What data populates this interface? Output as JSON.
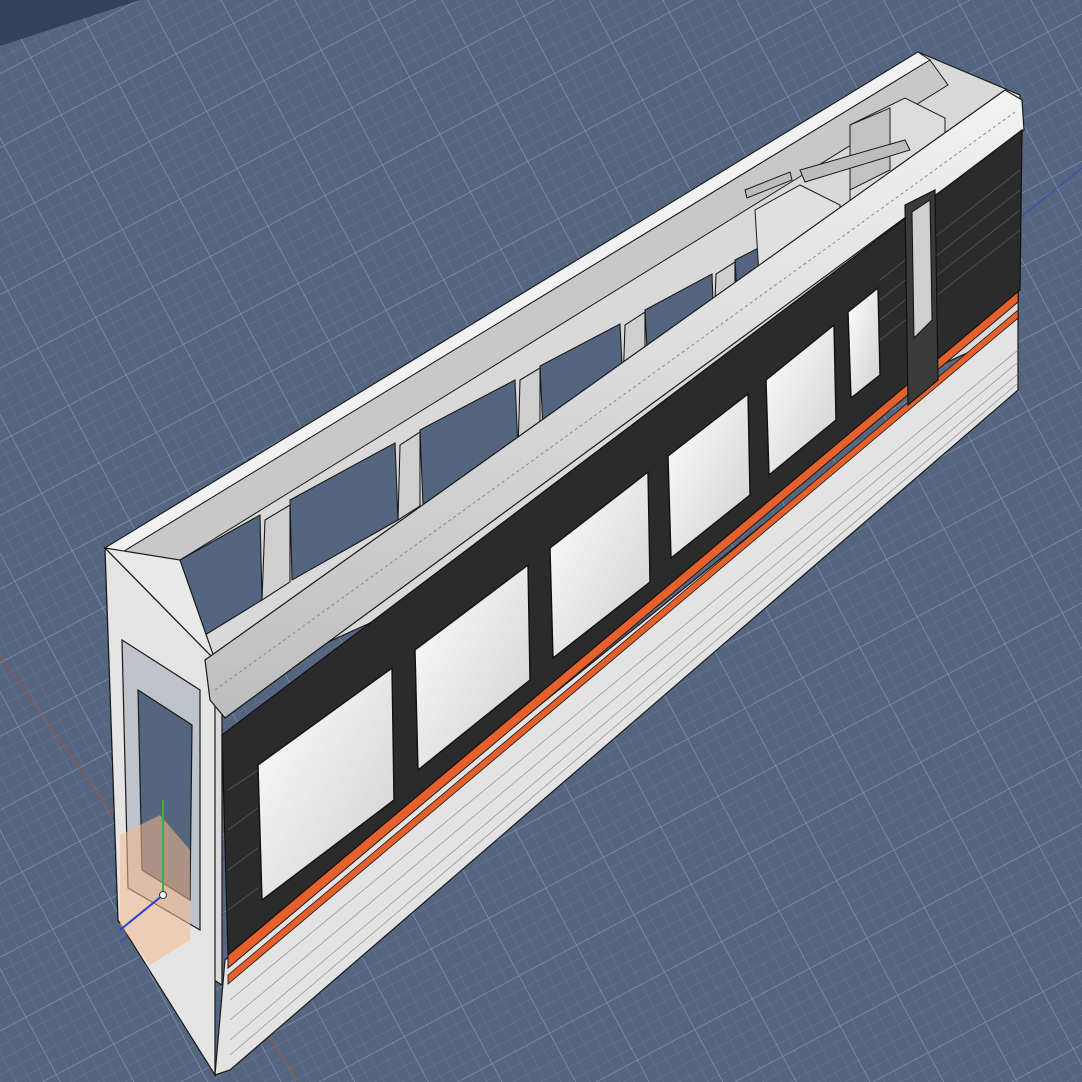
{
  "app": {
    "view": "3D viewport"
  },
  "colors": {
    "grid_background": "#54657f",
    "grid_minor": "#6f7f97",
    "grid_major": "#8a99ae",
    "body_light": "#e6e6e6",
    "body_mid": "#c9c9c9",
    "body_shadow": "#a9a9a9",
    "window_band": "#2b2b2b",
    "stripe": "#e6602b",
    "glass": "#efefef",
    "outline": "#1a1a1a",
    "axis_x": "#c4442f",
    "axis_y": "#3fae3a",
    "axis_z": "#2a3ee0",
    "gizmo": "#f4b98a"
  },
  "model": {
    "object": "railcar-body-shell",
    "side_windows": 5,
    "roof_openings": 6,
    "stripe_color": "orange"
  },
  "gizmo": {
    "icon": "move-gizmo-icon"
  }
}
